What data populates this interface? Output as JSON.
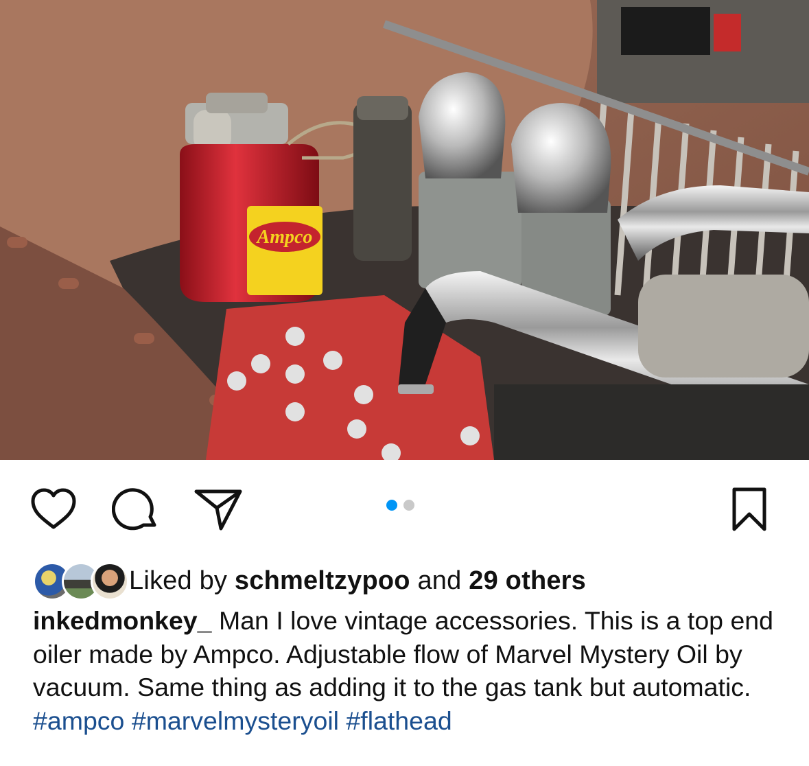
{
  "colors": {
    "accent": "#0095f6",
    "link": "#1b4f8f",
    "text": "#111111"
  },
  "photo": {
    "icon": "engine-photo",
    "label_text": "Ampco"
  },
  "actions": {
    "like_icon": "heart-icon",
    "comment_icon": "comment-icon",
    "share_icon": "paper-plane-icon",
    "save_icon": "bookmark-icon",
    "carousel": {
      "total": 2,
      "active": 1
    }
  },
  "likes": {
    "prefix": "Liked by",
    "user": "schmeltzypoo",
    "connector": "and",
    "others": "29 others"
  },
  "caption": {
    "username": "inkedmonkey_",
    "text": "Man I love vintage accessories. This is a top end oiler made by Ampco. Adjustable flow of Marvel Mystery Oil by vacuum. Same thing as adding it to the gas tank but automatic.",
    "hashtags": [
      "#ampco",
      "#marvelmysteryoil",
      "#flathead"
    ]
  }
}
